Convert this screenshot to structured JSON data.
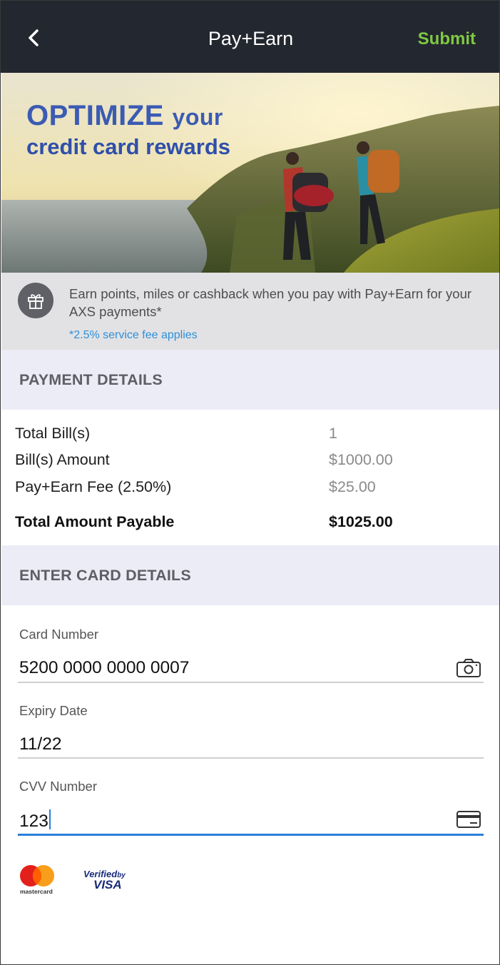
{
  "header": {
    "title": "Pay+Earn",
    "submit_label": "Submit",
    "back_icon": "chevron-left-icon"
  },
  "banner": {
    "headline_big": "OPTIMIZE",
    "headline_small": "your",
    "headline_line2": "credit card rewards"
  },
  "promo": {
    "icon": "gift-icon",
    "text": "Earn points, miles or cashback when you pay with Pay+Earn for your AXS payments*",
    "fee_note": "*2.5% service fee applies"
  },
  "payment_details": {
    "heading": "PAYMENT DETAILS",
    "rows": [
      {
        "label": "Total Bill(s)",
        "value": "1"
      },
      {
        "label": "Bill(s) Amount",
        "value": "$1000.00"
      },
      {
        "label": "Pay+Earn Fee (2.50%)",
        "value": "$25.00"
      }
    ],
    "total": {
      "label": "Total Amount Payable",
      "value": "$1025.00"
    }
  },
  "card_details": {
    "heading": "ENTER CARD DETAILS",
    "card_number": {
      "label": "Card Number",
      "value": "5200 0000 0000 0007",
      "icon": "camera-icon"
    },
    "expiry": {
      "label": "Expiry Date",
      "value": "11/22"
    },
    "cvv": {
      "label": "CVV Number",
      "value": "123",
      "icon": "credit-card-icon"
    }
  },
  "logos": {
    "mastercard_text": "mastercard",
    "verified_by": "Verified",
    "verified_by_suffix": "by",
    "visa": "VISA"
  },
  "colors": {
    "header_bg": "#23272f",
    "submit": "#7fc943",
    "accent_blue": "#2a7fd8",
    "section_bg": "#ececf7",
    "promo_bg": "#e2e2e4"
  }
}
